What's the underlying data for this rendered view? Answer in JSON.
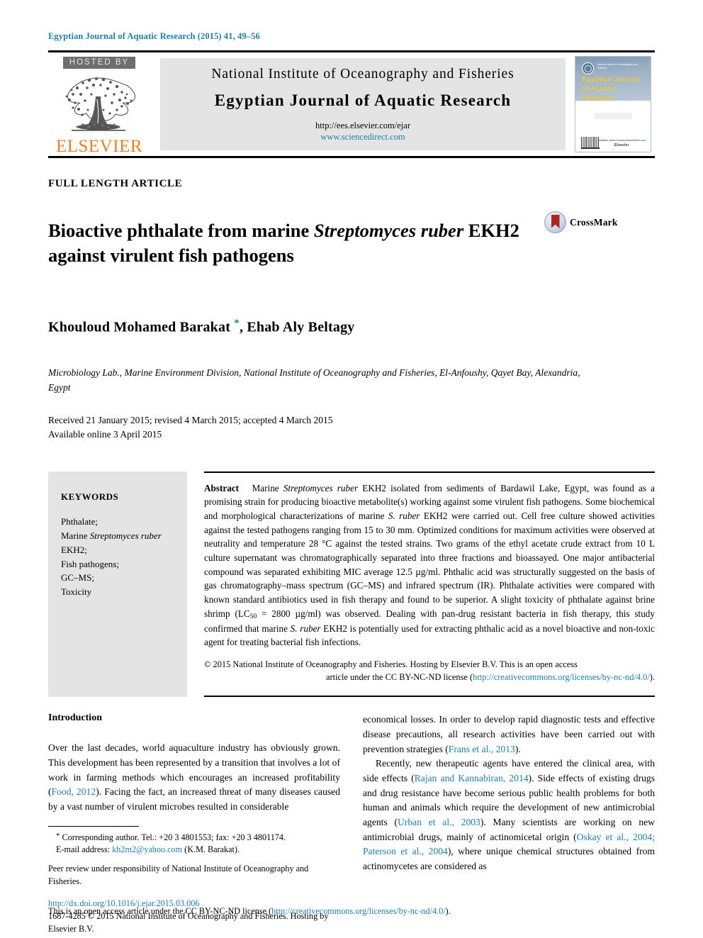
{
  "running_head": "Egyptian Journal of Aquatic Research (2015) 41, 49–56",
  "masthead": {
    "hosted_by": "HOSTED BY",
    "publisher_wordmark": "ELSEVIER",
    "institute": "National Institute of Oceanography and Fisheries",
    "journal_title": "Egyptian Journal of Aquatic Research",
    "submission_url": "http://ees.elsevier.com/ejar",
    "sciencedirect_url": "www.sciencedirect.com",
    "cover": {
      "org_line": "National Institute of Oceanography and Fisheries",
      "title": "Egyptian Journal of Aquatic Research",
      "publisher": "Elsevier",
      "publisher_tag": "Available online at www.sciencedirect.com"
    }
  },
  "article": {
    "section_label": "FULL LENGTH ARTICLE",
    "title_part1": "Bioactive phthalate from marine ",
    "title_italic1": "Streptomyces",
    "title_italic2": "ruber",
    "title_part2": " EKH2 against virulent fish pathogens",
    "crossmark_label": "CrossMark",
    "authors": "Khouloud Mohamed Barakat ",
    "corresponding_marker": "*",
    "authors_rest": ", Ehab Aly Beltagy",
    "affiliation": "Microbiology Lab., Marine Environment Division, National Institute of Oceanography and Fisheries, El-Anfoushy, Qayet Bay, Alexandria, Egypt",
    "received": "Received 21 January 2015; revised 4 March 2015; accepted 4 March 2015",
    "available": "Available online 3 April 2015"
  },
  "keywords": {
    "heading": "KEYWORDS",
    "items": [
      {
        "pre": "Phthalate;",
        "italic": "",
        "post": ""
      },
      {
        "pre": "Marine ",
        "italic": "Streptomyces ruber",
        "post": ""
      },
      {
        "pre": "EKH2;",
        "italic": "",
        "post": ""
      },
      {
        "pre": "Fish pathogens;",
        "italic": "",
        "post": ""
      },
      {
        "pre": "GC–MS;",
        "italic": "",
        "post": ""
      },
      {
        "pre": "Toxicity",
        "italic": "",
        "post": ""
      }
    ]
  },
  "abstract": {
    "label": "Abstract",
    "p1_a": "Marine ",
    "p1_i1": "Streptomyces ruber",
    "p1_b": " EKH2 isolated from sediments of Bardawil Lake, Egypt, was found as a promising strain for producing bioactive metabolite(s) working against some virulent fish pathogens. Some biochemical and morphological characterizations of marine ",
    "p1_i2": "S. ruber",
    "p1_c": " EKH2 were carried out. Cell free culture showed activities against the tested pathogens ranging from 15 to 30 mm. Optimized conditions for maximum activities were observed at neutrality and temperature 28 °C against the tested strains. Two grams of the ethyl acetate crude extract from 10 L culture supernatant was chromatographically separated into three fractions and bioassayed. One major antibacterial compound was separated exhibiting MIC average 12.5 µg/ml. Phthalic acid was structurally suggested on the basis of gas chromatography–mass spectrum (GC–MS) and infrared spectrum (IR). Phthalate activities were compared with known standard antibiotics used in fish therapy and found to be superior. A slight toxicity of phthalate against brine shrimp (LC",
    "p1_sub": "50",
    "p1_d": " = 2800 µg/ml) was observed. Dealing with pan-drug resistant bacteria in fish therapy, this study confirmed that marine ",
    "p1_i3": "S. ruber",
    "p1_e": " EKH2 is potentially used for extracting phthalic acid as a novel bioactive and non-toxic agent for treating bacterial fish infections.",
    "copyright_line1": "© 2015 National Institute of Oceanography and Fisheries. Hosting by Elsevier B.V. This is an open access",
    "copyright_line2_pre": "article under the CC BY-NC-ND license (",
    "copyright_link": "http://creativecommons.org/licenses/by-nc-nd/4.0/",
    "copyright_line2_post": ")."
  },
  "introduction": {
    "heading": "Introduction",
    "left_p1_a": "Over the last decades, world aquaculture industry has obviously grown. This development has been represented by a transition that involves a lot of work in farming methods which encourages an increased profitability (",
    "left_cite1": "Food, 2012",
    "left_p1_b": "). Facing the fact, an increased threat of many diseases caused by a vast number of virulent microbes resulted in considerable",
    "right_p1_a": "economical losses. In order to develop rapid diagnostic tests and effective disease precautions, all research activities have been carried out with prevention strategies (",
    "right_cite1": "Frans et al., 2013",
    "right_p1_b": ").",
    "right_p2_a": "Recently, new therapeutic agents have entered the clinical area, with side effects (",
    "right_cite2": "Rajan and Kannabiran, 2014",
    "right_p2_b": "). Side effects of existing drugs and drug resistance have become serious public health problems for both human and animals which require the development of new antimicrobial agents (",
    "right_cite3": "Urban et al., 2003",
    "right_p2_c": "). Many scientists are working on new antimicrobial drugs, mainly of actinomicetal origin (",
    "right_cite4": "Oskay et al., 2004; Paterson et al., 2004",
    "right_p2_d": "), where unique chemical structures obtained from actinomycetes are considered as"
  },
  "footnotes": {
    "corresponding": "Corresponding author. Tel.: +20 3 4801553; fax: +20 3 4801174.",
    "email_label": "E-mail address: ",
    "email": "kh2m2@yahoo.com",
    "email_suffix": " (K.M. Barakat).",
    "peer_review": "Peer review under responsibility of National Institute of Oceanography and Fisheries."
  },
  "footer": {
    "doi": "http://dx.doi.org/10.1016/j.ejar.2015.03.006",
    "issn_line": "1687-4285 © 2015 National Institute of Oceanography and Fisheries. Hosting by Elsevier B.V.",
    "license_pre": "This is an open access article under the CC BY-NC-ND license (",
    "license_link": "http://creativecommons.org/licenses/by-nc-nd/4.0/",
    "license_post": ")."
  },
  "colors": {
    "link": "#1a7fab",
    "elsevier_orange": "#f07d20",
    "panel_gray": "#e4e4e4",
    "badge_gray": "#6e6e6e"
  }
}
